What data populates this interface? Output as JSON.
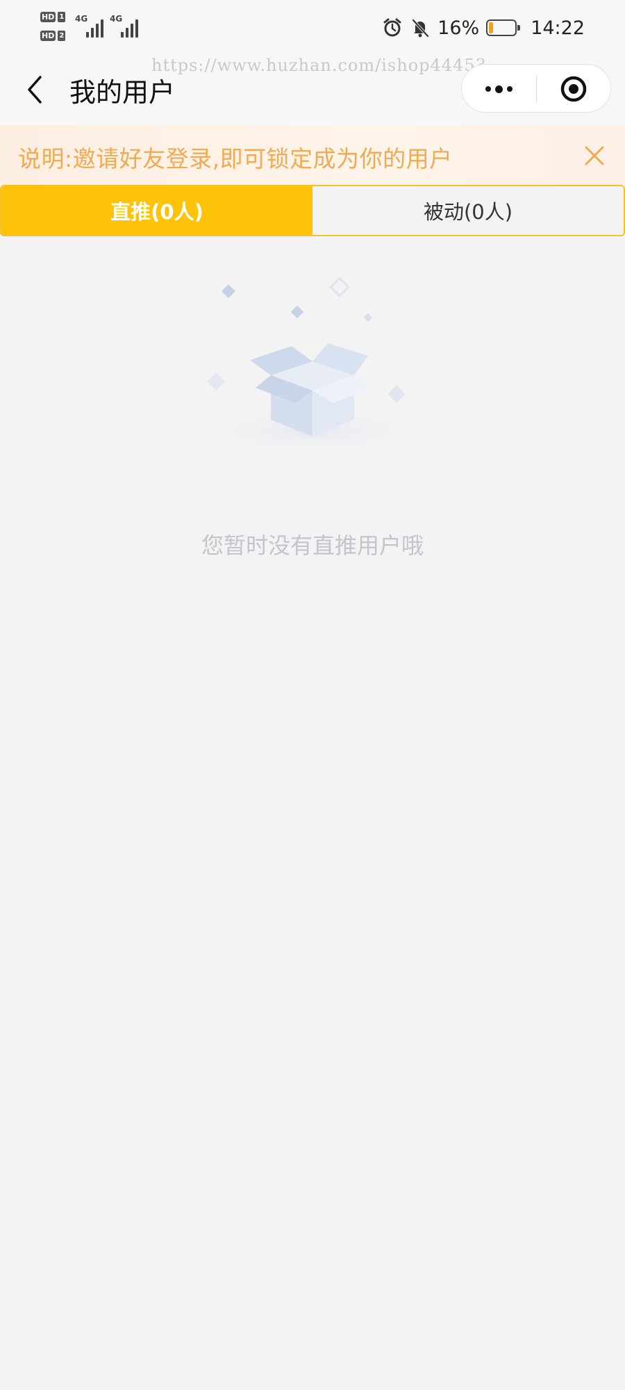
{
  "status_bar": {
    "sim1_label": "HD",
    "sim1_num": "1",
    "sim2_label": "HD",
    "sim2_num": "2",
    "network_1": "4G",
    "network_2": "4G",
    "battery_percent": "16%",
    "battery_level": 0.16,
    "battery_color": "#f2a31b",
    "time": "14:22",
    "icons": [
      "alarm-icon",
      "bell-off-icon"
    ]
  },
  "nav": {
    "title": "我的用户",
    "watermark": "https://www.huzhan.com/ishop44453",
    "back_icon": "chevron-left-icon",
    "more_icon": "more-dots-icon",
    "close_icon": "target-circle-icon"
  },
  "notice": {
    "text": "说明:邀请好友登录,即可锁定成为你的用户",
    "text_color": "#efab54",
    "close_icon": "close-icon"
  },
  "tabs": [
    {
      "label": "直推(0人)",
      "active": true
    },
    {
      "label": "被动(0人)",
      "active": false
    }
  ],
  "accent_color": "#fdc308",
  "empty_state": {
    "illustration_icon": "empty-box-icon",
    "message": "您暂时没有直推用户哦"
  }
}
